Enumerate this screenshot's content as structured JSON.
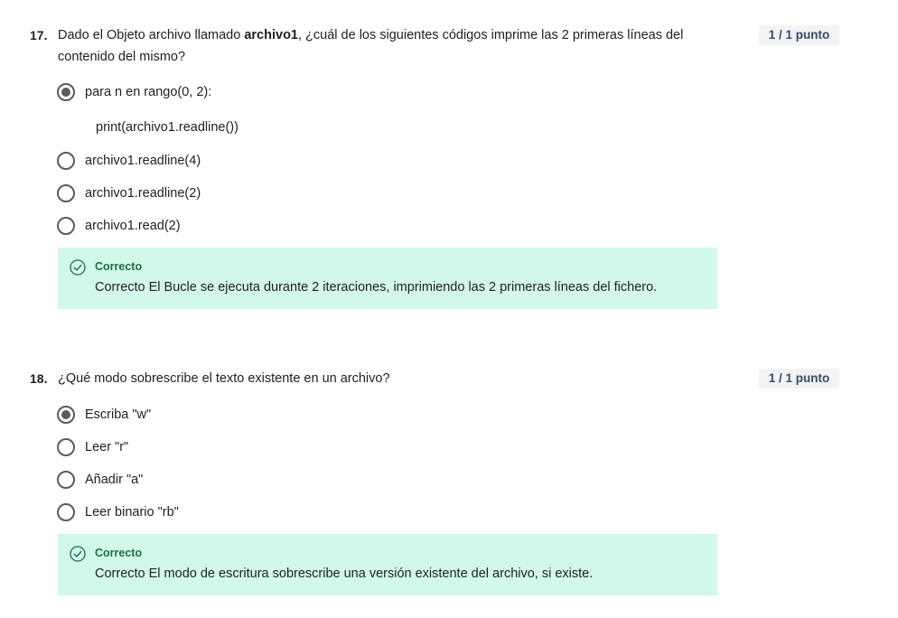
{
  "questions": [
    {
      "number": "17.",
      "text_prefix": "Dado el Objeto archivo llamado ",
      "text_bold": "archivo1",
      "text_suffix": ", ¿cuál de los siguientes códigos imprime las 2 primeras líneas del contenido del mismo?",
      "points": "1 / 1 punto",
      "options": [
        {
          "label": "para n en rango(0, 2):",
          "extra": "print(archivo1.readline())",
          "selected": true
        },
        {
          "label": "archivo1.readline(4)",
          "selected": false
        },
        {
          "label": "archivo1.readline(2)",
          "selected": false
        },
        {
          "label": "archivo1.read(2)",
          "selected": false
        }
      ],
      "feedback": {
        "title": "Correcto",
        "text": "Correcto El Bucle se ejecuta durante 2 iteraciones, imprimiendo las 2 primeras líneas del fichero.",
        "icon": "check-circle-icon"
      }
    },
    {
      "number": "18.",
      "text": "¿Qué modo sobrescribe el texto existente en un archivo?",
      "points": "1 / 1 punto",
      "options": [
        {
          "label": "Escriba \"w\"",
          "selected": true
        },
        {
          "label": "Leer \"r\"",
          "selected": false
        },
        {
          "label": "Añadir \"a\"",
          "selected": false
        },
        {
          "label": "Leer binario \"rb\"",
          "selected": false
        }
      ],
      "feedback": {
        "title": "Correcto",
        "text": "Correcto El modo de escritura sobrescribe una versión existente del archivo, si existe.",
        "icon": "check-circle-icon"
      }
    }
  ],
  "colors": {
    "feedback_bg": "#d2f8ea",
    "feedback_title": "#1d6f47",
    "points_bg": "#f1f3f6",
    "radio": "#5b5b5b"
  }
}
